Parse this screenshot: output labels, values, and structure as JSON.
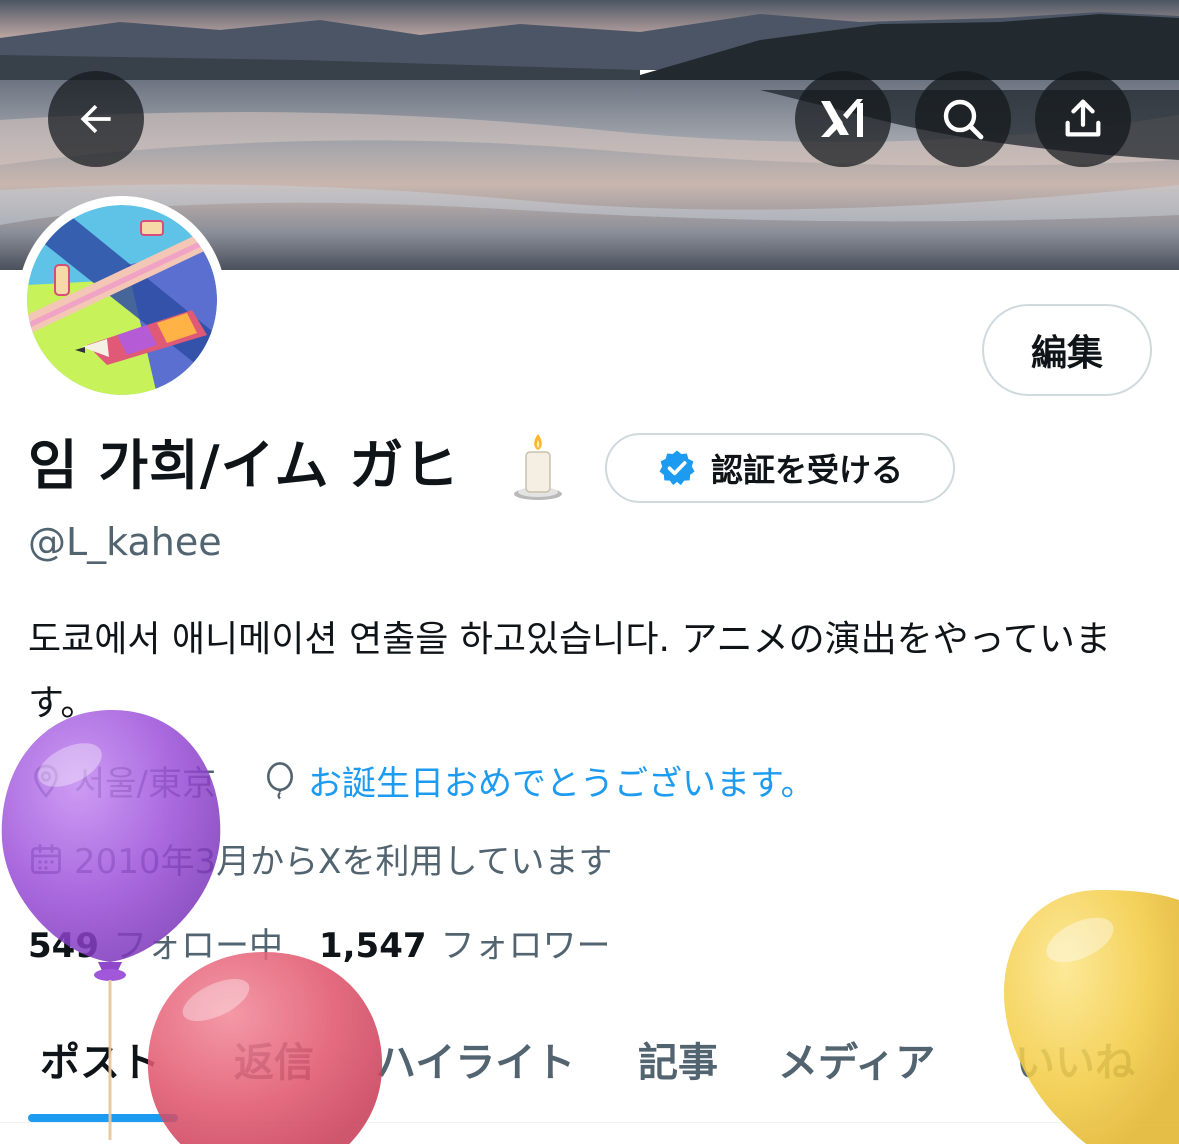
{
  "header": {
    "back_icon": "arrow-left-icon",
    "grok_icon": "grok-logo-icon",
    "search_icon": "search-icon",
    "share_icon": "share-upload-icon"
  },
  "profile": {
    "display_name": "임 가희/イム ガヒ",
    "name_emoji": "candle-icon",
    "handle": "@L_kahee",
    "edit_label": "編集",
    "verify_label": "認証を受ける",
    "bio": "도쿄에서 애니메이션 연출을 하고있습니다. アニメの演出をやっています。",
    "location": "서울/東京",
    "birthday_text": "お誕生日おめでとうございます。",
    "joined": "2010年3月からXを利用しています",
    "following_count": "549",
    "following_label": "フォロー中",
    "followers_count": "1,547",
    "followers_label": "フォロワー"
  },
  "tabs": [
    {
      "label": "ポスト",
      "active": true
    },
    {
      "label": "返信",
      "active": false
    },
    {
      "label": "ハイライト",
      "active": false
    },
    {
      "label": "記事",
      "active": false
    },
    {
      "label": "メディア",
      "active": false
    },
    {
      "label": "いいね",
      "active": false
    }
  ],
  "colors": {
    "accent": "#1d9bf0",
    "text_primary": "#0f1419",
    "text_secondary": "#536471",
    "balloon_purple": "#9b4fd9",
    "balloon_red": "#e0566e",
    "balloon_yellow": "#f2cc47"
  }
}
